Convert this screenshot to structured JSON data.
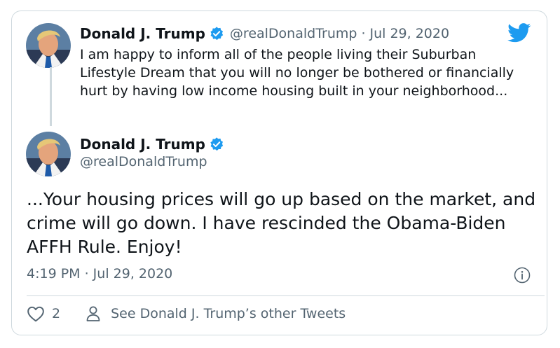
{
  "embedded_tweet": {
    "display_name": "Donald J. Trump",
    "handle": "@realDonaldTrump",
    "separator": "·",
    "date": "Jul 29, 2020",
    "text": "I am happy to inform all of the people living their Suburban Lifestyle Dream that you will no longer be bothered or financially hurt by having low income housing built in your neighborhood..."
  },
  "main_tweet": {
    "display_name": "Donald J. Trump",
    "handle": "@realDonaldTrump",
    "text": "...Your housing prices will go up based on the market, and crime will go down. I have rescinded the Obama-Biden AFFH Rule. Enjoy!",
    "timestamp": "4:19 PM · Jul 29, 2020"
  },
  "actions": {
    "like_count": "2",
    "other_tweets_label": "See Donald J. Trump’s other Tweets"
  },
  "icons": {
    "brand": "twitter-bird-icon",
    "verified": "verified-badge-icon",
    "info": "info-icon",
    "like": "heart-icon",
    "profile": "person-icon"
  },
  "colors": {
    "brand_blue": "#1d9bf0",
    "text_primary": "#0f1419",
    "text_secondary": "#536471",
    "border": "#cfd9de"
  }
}
